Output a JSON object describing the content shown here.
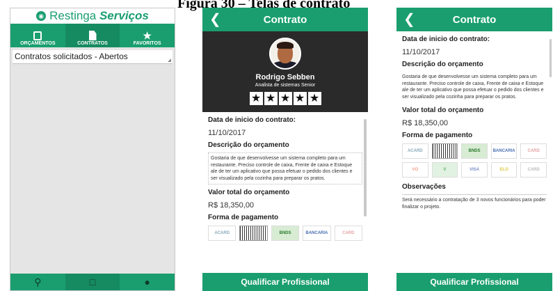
{
  "caption": "Figura 30 – Telas de contrato",
  "screen1": {
    "brand_prefix": "Restinga",
    "brand_suffix": "Serviços",
    "tabs": [
      {
        "label": "ORÇAMENTOS",
        "icon": "clipboard-check-icon"
      },
      {
        "label": "CONTRATOS",
        "icon": "document-icon"
      },
      {
        "label": "FAVORITOS",
        "icon": "star-icon"
      }
    ],
    "dropdown_value": "Contratos solicitados - Abertos",
    "bottom_nav": [
      "search-icon",
      "clipboard-icon",
      "user-icon"
    ]
  },
  "contract": {
    "title": "Contrato",
    "name": "Rodrigo Sebben",
    "role": "Analista de sistemas Senior",
    "stars": [
      "★",
      "★",
      "★",
      "★",
      "★"
    ],
    "date_label": "Data de inicio do contrato:",
    "date_value": "11/10/2017",
    "desc_label": "Descrição do orçamento",
    "desc_text": "Gostaria de que desenvolvesse um sistema completo para um restaurante. Preciso controle de caixa, Frente de caixa e Estoque ale de ter um aplicativo que possa efetuar o pedido dos clientes e ser visualizado pela cozinha para preparar os pratos.",
    "total_label": "Valor total do orçamento",
    "total_value": "R$ 18,350,00",
    "payment_label": "Forma de pagamento",
    "payments_row1": [
      "ACARD",
      "",
      "BNDS",
      "BANCARIA",
      "CARD"
    ],
    "payments_row2": [
      "VO",
      "V",
      "VISA",
      "ELO",
      "CARD"
    ],
    "obs_label": "Observações",
    "obs_text": "Será necessário a contratação de 3 novos funcionários para poder finalizar o projeto.",
    "button": "Qualificar Profissional"
  }
}
